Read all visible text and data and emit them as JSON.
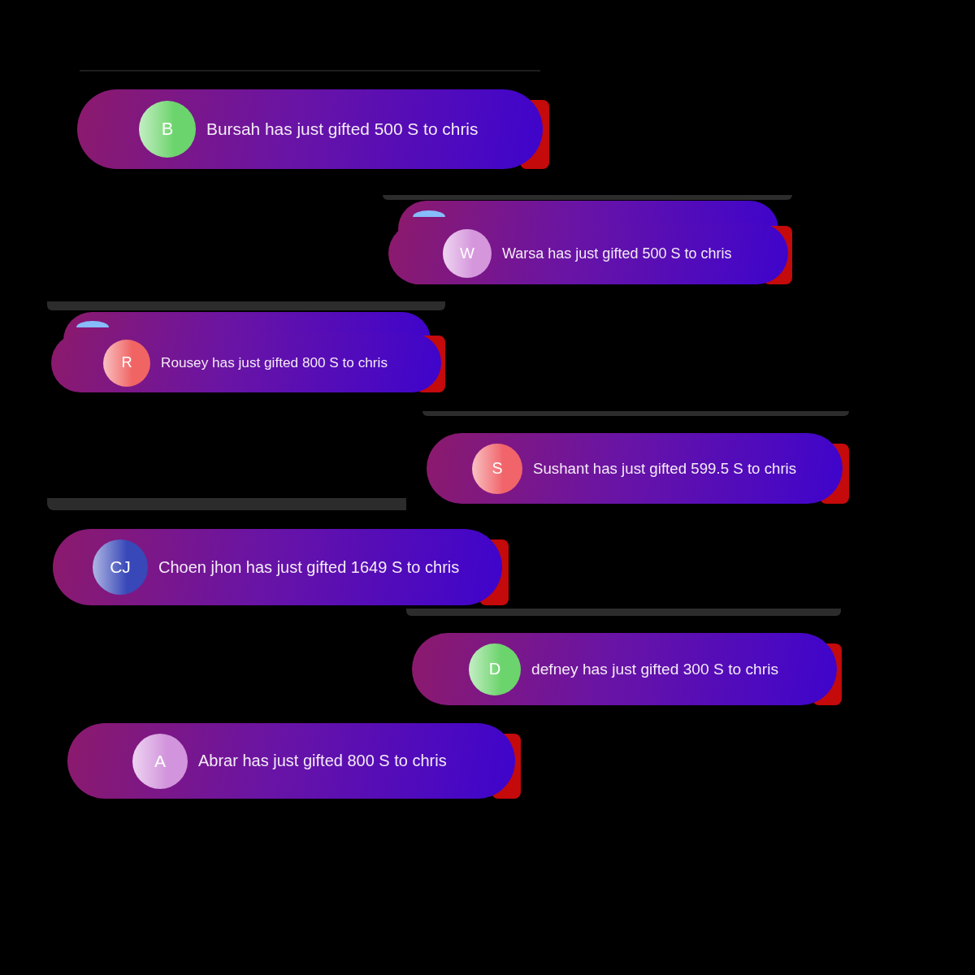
{
  "notifications": [
    {
      "kind": "single",
      "avatar": {
        "initials": "B",
        "color": "#6cd46c"
      },
      "message": "Bursah has just gifted 500 S to chris"
    },
    {
      "kind": "stacked",
      "avatar": {
        "initials": "W",
        "color": "#d596dc"
      },
      "message": "Warsa has just gifted 500 S to chris"
    },
    {
      "kind": "stacked",
      "avatar": {
        "initials": "R",
        "color": "#f06464"
      },
      "message": "Rousey has just gifted 800 S to chris"
    },
    {
      "kind": "single",
      "avatar": {
        "initials": "S",
        "color": "#f0646a"
      },
      "message": "Sushant has just gifted 599.5 S to chris"
    },
    {
      "kind": "single",
      "avatar": {
        "initials": "CJ",
        "color": "#3848b8"
      },
      "message": "Choen jhon has just gifted 1649 S to chris"
    },
    {
      "kind": "single",
      "avatar": {
        "initials": "D",
        "color": "#6cd46c"
      },
      "message": "defney has just gifted 300 S to chris"
    },
    {
      "kind": "single",
      "avatar": {
        "initials": "A",
        "color": "#d294dc"
      },
      "message": "Abrar has just gifted 800 S to chris"
    }
  ]
}
